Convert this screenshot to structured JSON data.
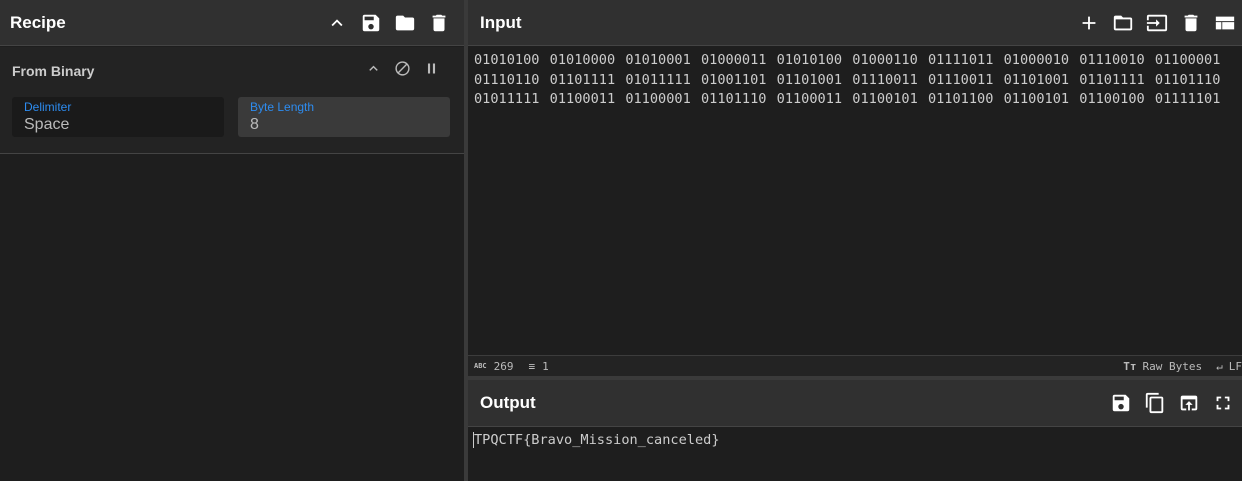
{
  "recipe": {
    "title": "Recipe",
    "operation": {
      "name": "From Binary",
      "fields": [
        {
          "label": "Delimiter",
          "value": "Space"
        },
        {
          "label": "Byte Length",
          "value": "8"
        }
      ]
    }
  },
  "input": {
    "title": "Input",
    "text": "01010100 01010000 01010001 01000011 01010100 01000110 01111011 01000010 01110010 01100001 01110110 01101111 01011111 01001101 01101001 01110011 01110011 01101001 01101111 01101110 01011111 01100011 01100001 01101110 01100011 01100101 01101100 01100101 01100100 01111101",
    "status": {
      "length": "269",
      "lines": "1",
      "encoding": "Raw Bytes",
      "eol": "LF"
    }
  },
  "output": {
    "title": "Output",
    "text": "TPQCTF{Bravo_Mission_canceled}"
  }
}
